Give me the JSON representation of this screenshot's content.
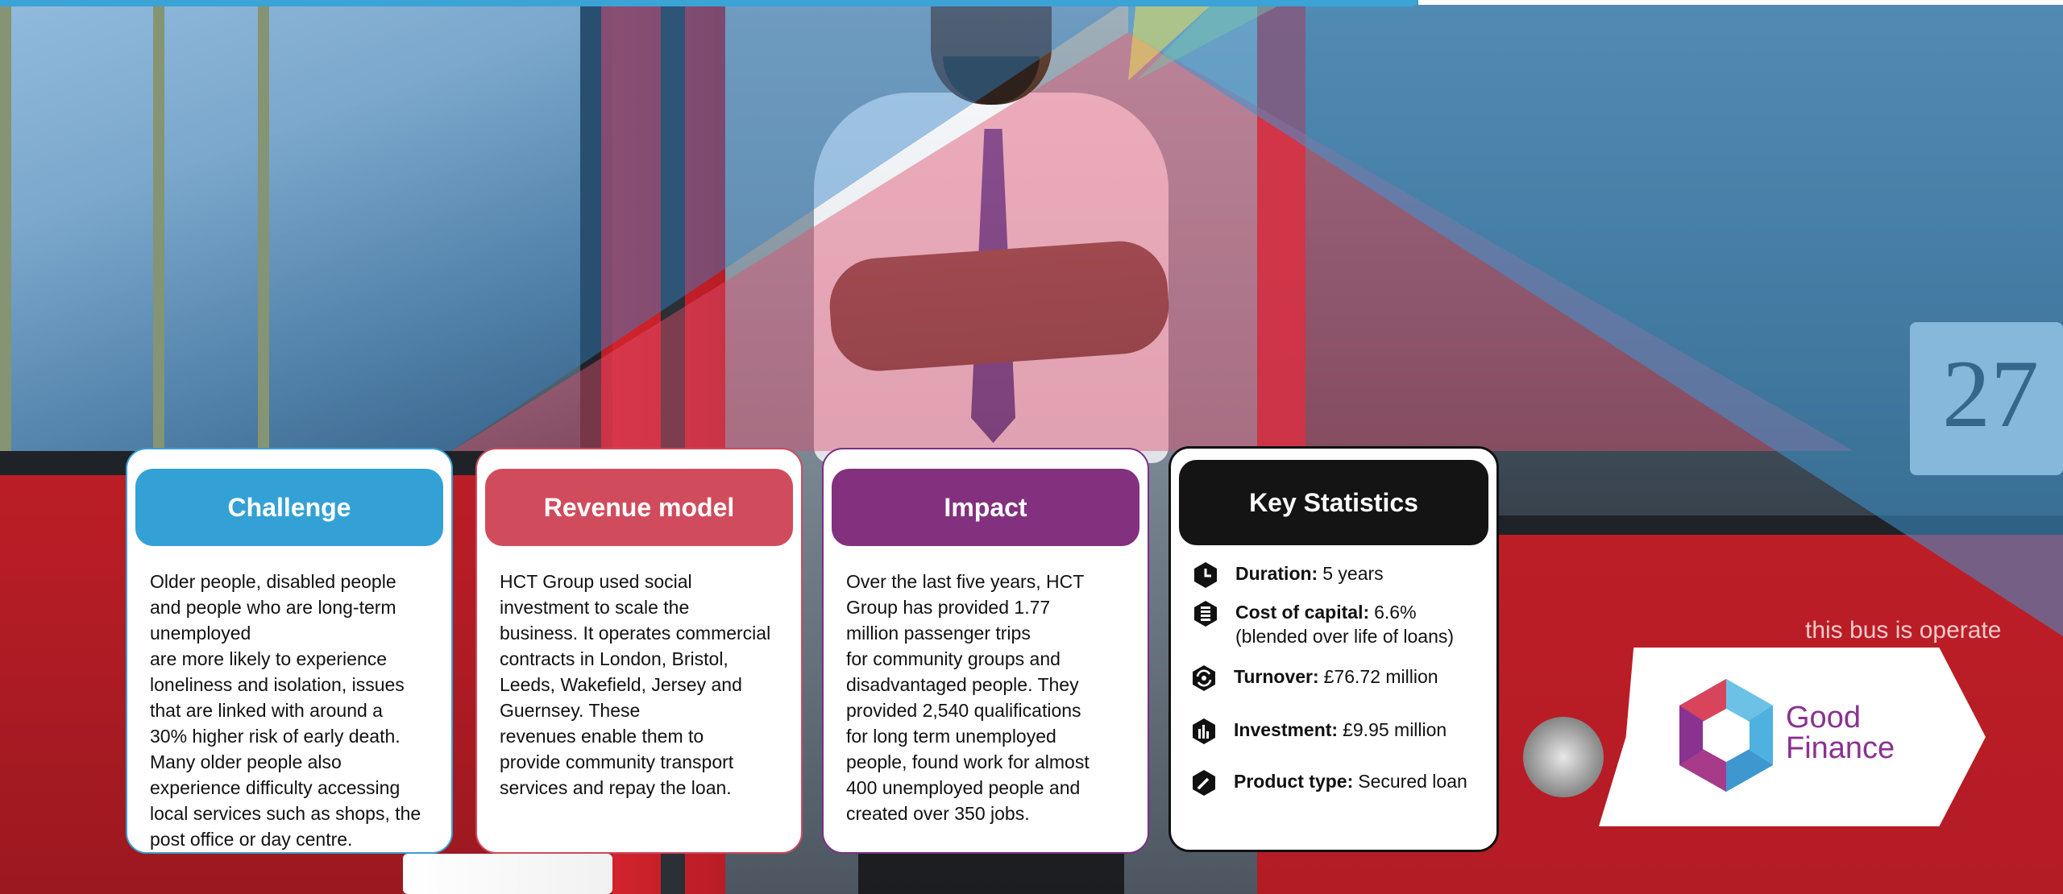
{
  "cards": {
    "challenge": {
      "title": "Challenge",
      "lines": [
        "Older people, disabled people",
        "and people who are long-term",
        "unemployed",
        "are more likely to experience",
        "loneliness and isolation, issues",
        "that are linked with around a",
        "30% higher risk of early death.",
        "Many older people also",
        "experience difficulty accessing",
        "local services such as shops, the",
        "post office or day centre."
      ]
    },
    "revenue": {
      "title": "Revenue model",
      "lines": [
        "HCT Group used social",
        "investment to scale the",
        "business. It operates commercial",
        "contracts in London, Bristol,",
        "Leeds, Wakefield, Jersey and",
        "Guernsey. These",
        "revenues enable them to",
        "provide community transport",
        "services and repay the loan."
      ]
    },
    "impact": {
      "title": "Impact",
      "lines": [
        "Over the last five years, HCT",
        "Group has provided 1.77",
        "million passenger trips",
        "for community groups and",
        "disadvantaged people. They",
        "provided 2,540 qualifications",
        "for long term unemployed",
        "people, found work for almost",
        "400 unemployed people and",
        "created over 350 jobs."
      ]
    },
    "stats": {
      "title": "Key Statistics",
      "items": [
        {
          "icon": "clock-icon",
          "label": "Duration:",
          "value": "5 years",
          "sub": ""
        },
        {
          "icon": "coins-icon",
          "label": "Cost of capital:",
          "value": "6.6%",
          "sub": "(blended over life of loans)"
        },
        {
          "icon": "refresh-money-icon",
          "label": "Turnover:",
          "value": "£76.72 million",
          "sub": ""
        },
        {
          "icon": "bar-chart-icon",
          "label": "Investment:",
          "value": "£9.95 million",
          "sub": ""
        },
        {
          "icon": "pen-icon",
          "label": "Product type:",
          "value": "Secured loan",
          "sub": ""
        }
      ]
    }
  },
  "background": {
    "bus_text": "this bus is operate",
    "bus_number": "27"
  },
  "logo": {
    "line1": "Good",
    "line2": "Finance"
  },
  "colors": {
    "challenge": "#34a1d6",
    "revenue": "#d04c5d",
    "impact": "#83307f",
    "stats": "#141414",
    "brand": "#8a3290"
  }
}
